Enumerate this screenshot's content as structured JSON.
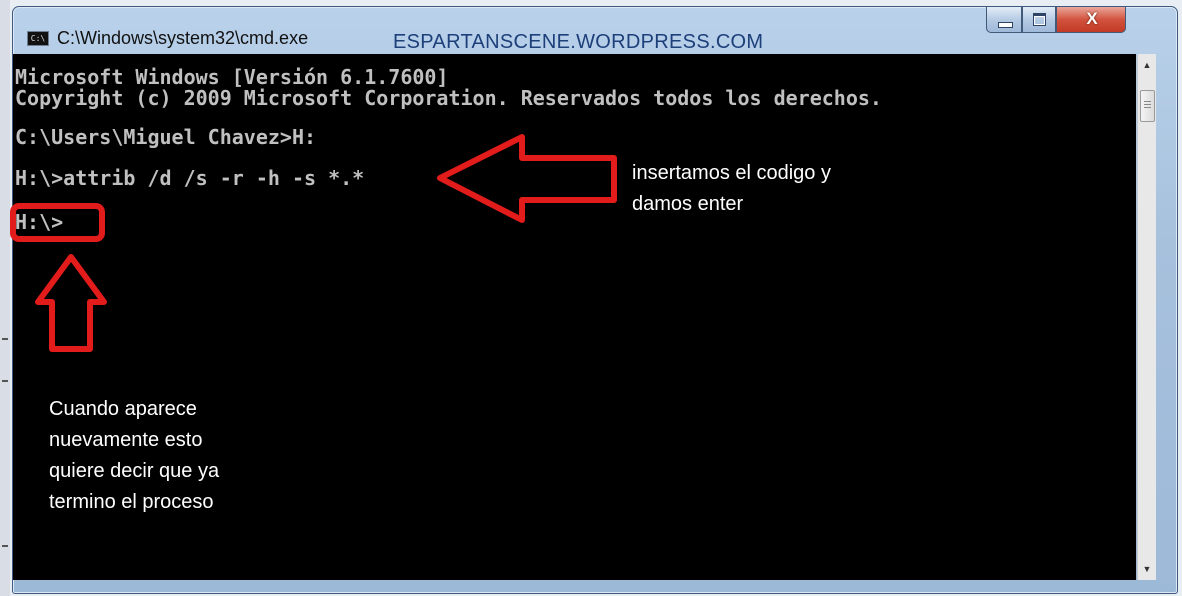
{
  "window": {
    "title": "C:\\Windows\\system32\\cmd.exe",
    "icon": "cmd-icon",
    "watermark": "ESPARTANSCENE.WORDPRESS.COM",
    "controls": {
      "minimize": "minimize-icon",
      "maximize": "maximize-icon",
      "close_label": "X"
    }
  },
  "console": {
    "lines": [
      "Microsoft Windows [Versión 6.1.7600]",
      "Copyright (c) 2009 Microsoft Corporation. Reservados todos los derechos.",
      "C:\\Users\\Miguel Chavez>H:",
      "H:\\>attrib /d /s -r -h -s *.*",
      "H:\\>"
    ],
    "text_color": "#c0c0c0",
    "background": "#000000"
  },
  "annotations": {
    "right_note": [
      "insertamos el codigo y",
      "damos enter"
    ],
    "bottom_note": [
      "Cuando aparece",
      "nuevamente esto",
      "quiere decir que ya",
      "termino el proceso"
    ],
    "marker_color": "#e21b1b"
  },
  "scrollbar": {
    "up": "scroll-up-arrow-icon",
    "down": "scroll-down-arrow-icon"
  }
}
